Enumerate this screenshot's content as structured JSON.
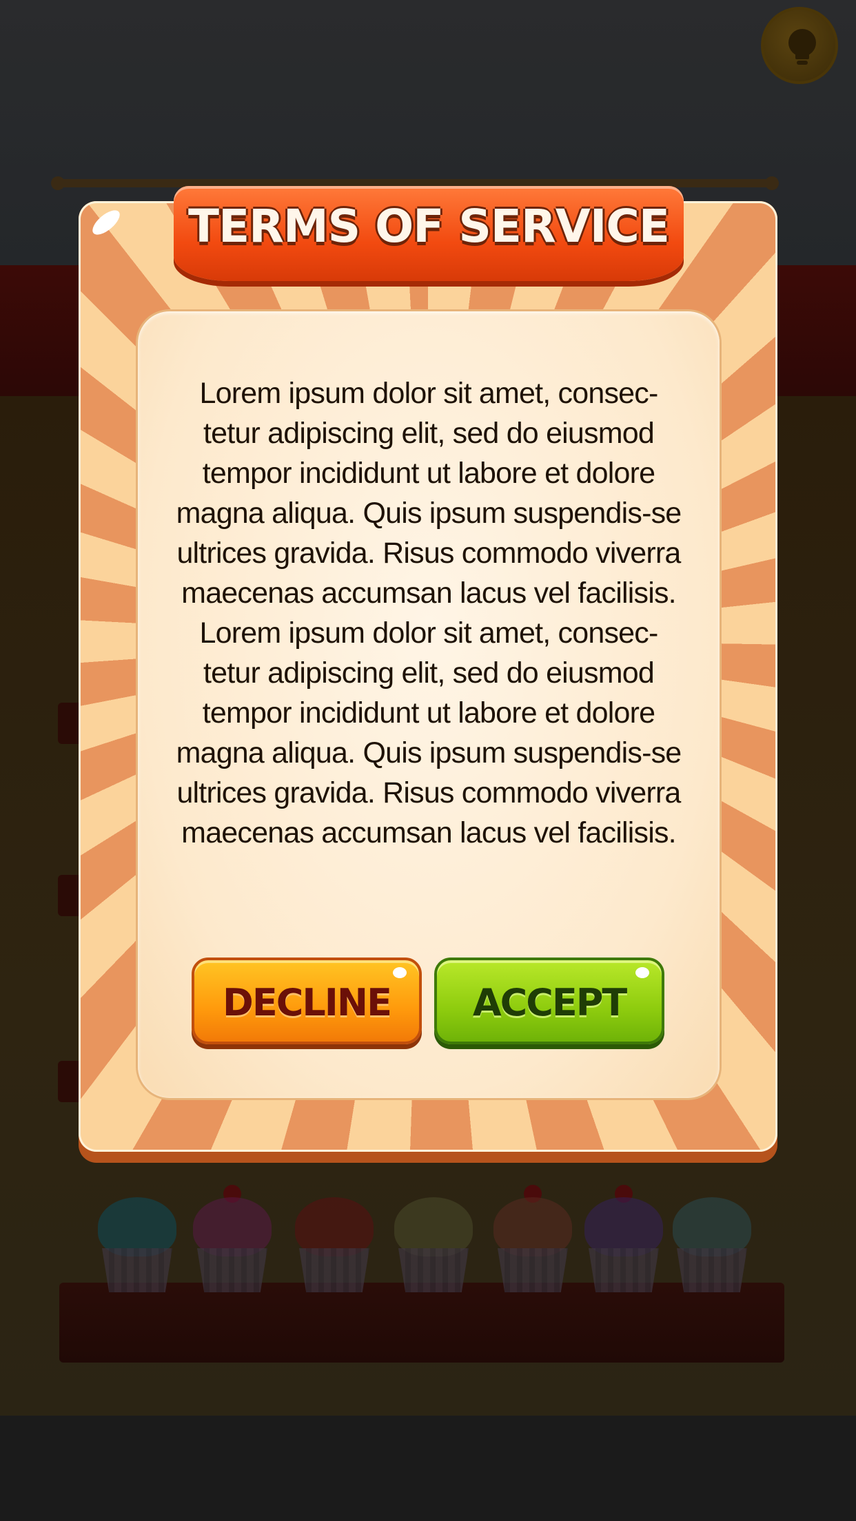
{
  "dialog": {
    "title": "TERMS OF SERVICE",
    "paragraphs": [
      "Lorem ipsum dolor sit amet, consec-tetur adipiscing elit, sed do eiusmod tempor incididunt ut labore et dolore magna aliqua. Quis ipsum suspendis-se ultrices gravida. Risus commodo viverra maecenas accumsan lacus vel facilisis.",
      "Lorem ipsum dolor sit amet, consec-tetur adipiscing elit, sed do eiusmod tempor incididunt ut labore et dolore magna aliqua. Quis ipsum suspendis-se ultrices gravida. Risus commodo viverra maecenas accumsan lacus vel facilisis."
    ],
    "decline_label": "DECLINE",
    "accept_label": "ACCEPT"
  },
  "icons": {
    "hint": "lightbulb-icon"
  },
  "colors": {
    "title_ribbon": "#f24a10",
    "decline_button": "#ff9a0c",
    "accept_button": "#8ecc0e",
    "panel": "#fde9cc"
  }
}
